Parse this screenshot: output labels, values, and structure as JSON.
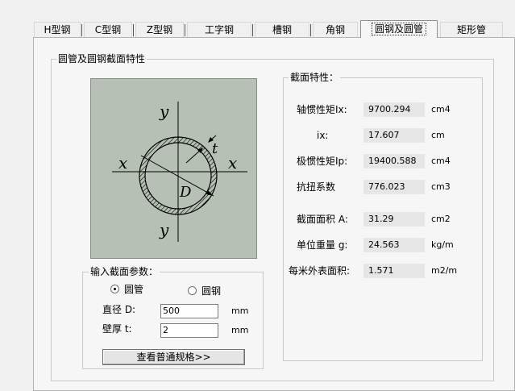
{
  "tabs": [
    {
      "label": "H型钢"
    },
    {
      "label": "C型钢"
    },
    {
      "label": "Z型钢"
    },
    {
      "label": "工字钢"
    },
    {
      "label": "槽钢"
    },
    {
      "label": "角钢"
    },
    {
      "label": "圆钢及圆管"
    },
    {
      "label": "矩形管"
    }
  ],
  "active_tab": "圆钢及圆管",
  "section_group": {
    "title": "圆管及圆钢截面特性"
  },
  "diagram": {
    "labels": {
      "y_top": "y",
      "y_bottom": "y",
      "x_left": "x",
      "x_right": "x",
      "t": "t",
      "D": "D"
    },
    "colors": {
      "background": "#b7c0b5",
      "hatch": "#000000"
    }
  },
  "input_group": {
    "title": "输入截面参数：",
    "radio_options": [
      {
        "label": "圆管",
        "selected": true
      },
      {
        "label": "圆钢",
        "selected": false
      }
    ],
    "fields": [
      {
        "label": "直径 D:",
        "value": "500",
        "unit": "mm"
      },
      {
        "label": "壁厚 t:",
        "value": "2",
        "unit": "mm"
      }
    ],
    "button_label": "查看普通规格>>"
  },
  "properties_group": {
    "title": "截面特性：",
    "rows": [
      {
        "label": "轴惯性矩Ix:",
        "value": "9700.294",
        "unit": "cm4"
      },
      {
        "label": "ix:",
        "value": "17.607",
        "unit": "cm"
      },
      {
        "label": "极惯性矩Ip:",
        "value": "19400.588",
        "unit": "cm4"
      },
      {
        "label": "抗扭系数",
        "value": "776.023",
        "unit": "cm3"
      },
      {
        "label": "截面面积 A:",
        "value": "31.29",
        "unit": "cm2"
      },
      {
        "label": "单位重量 g:",
        "value": "24.563",
        "unit": "kg/m"
      },
      {
        "label": "每米外表面积:",
        "value": "1.571",
        "unit": "m2/m"
      }
    ]
  }
}
